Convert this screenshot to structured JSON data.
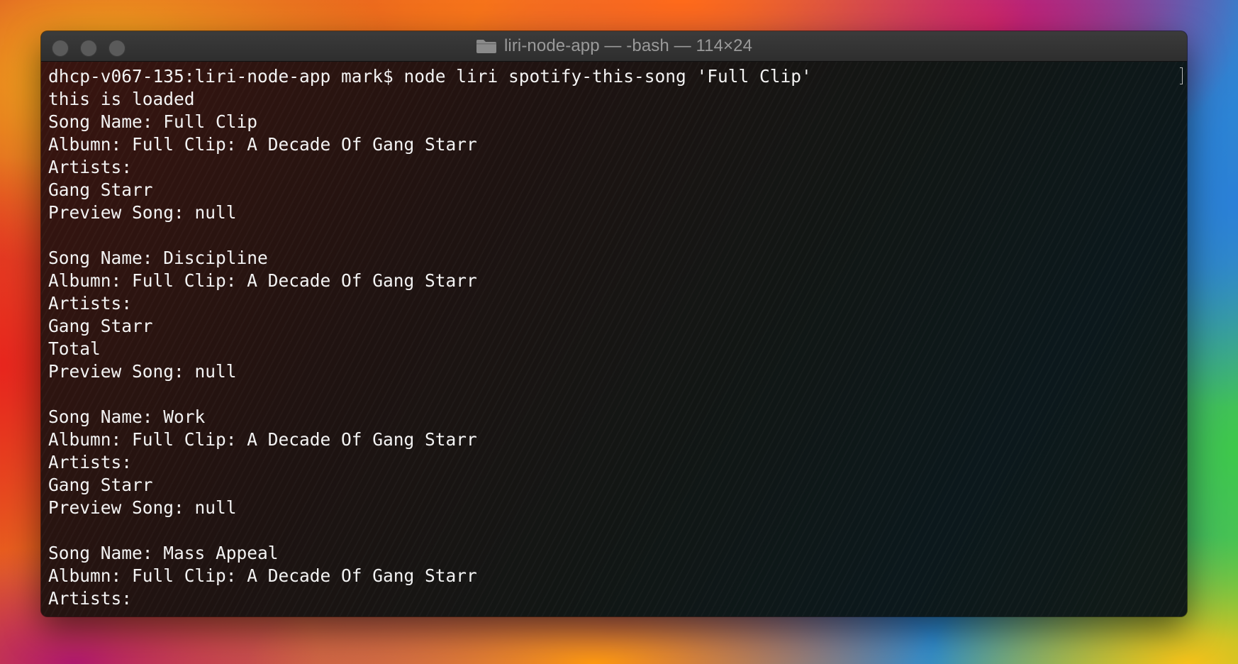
{
  "window": {
    "title": "liri-node-app — -bash — 114×24"
  },
  "terminal": {
    "lines": [
      "dhcp-v067-135:liri-node-app mark$ node liri spotify-this-song 'Full Clip'",
      "this is loaded",
      "Song Name: Full Clip",
      "Albumn: Full Clip: A Decade Of Gang Starr",
      "Artists:",
      "Gang Starr",
      "Preview Song: null",
      "",
      "Song Name: Discipline",
      "Albumn: Full Clip: A Decade Of Gang Starr",
      "Artists:",
      "Gang Starr",
      "Total",
      "Preview Song: null",
      "",
      "Song Name: Work",
      "Albumn: Full Clip: A Decade Of Gang Starr",
      "Artists:",
      "Gang Starr",
      "Preview Song: null",
      "",
      "Song Name: Mass Appeal",
      "Albumn: Full Clip: A Decade Of Gang Starr",
      "Artists:"
    ]
  },
  "icons": {
    "title_icon": "folder-icon"
  },
  "colors": {
    "text": "#f3f3f3",
    "title_text": "#9a9a9a",
    "titlebar": "#333333"
  }
}
